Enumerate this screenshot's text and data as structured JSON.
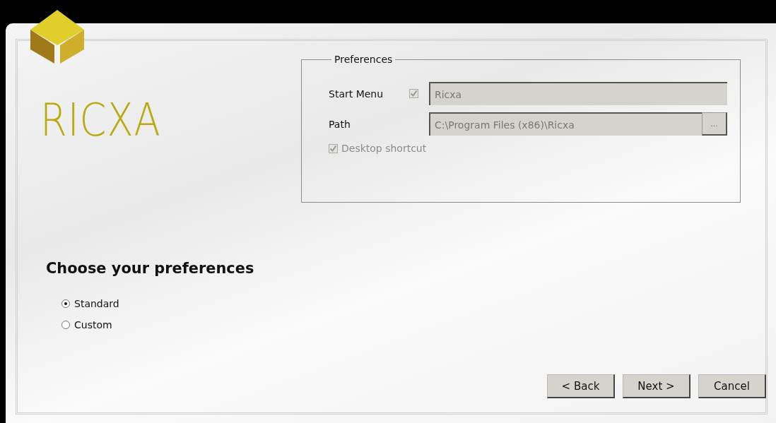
{
  "logo": {
    "text": "RICXA"
  },
  "preferences": {
    "title": "Preferences",
    "start_menu": {
      "label": "Start Menu",
      "checked": true,
      "disabled": true,
      "value": "Ricxa"
    },
    "path": {
      "label": "Path",
      "value": "C:\\Program Files (x86)\\Ricxa",
      "disabled": true,
      "browse_label": "..."
    },
    "desktop_shortcut": {
      "label": "Desktop shortcut",
      "checked": true,
      "disabled": true
    }
  },
  "heading": "Choose your preferences",
  "options": [
    {
      "label": "Standard",
      "selected": true
    },
    {
      "label": "Custom",
      "selected": false
    }
  ],
  "buttons": [
    {
      "label": "< Back"
    },
    {
      "label": "Next >"
    },
    {
      "label": "Cancel"
    }
  ]
}
